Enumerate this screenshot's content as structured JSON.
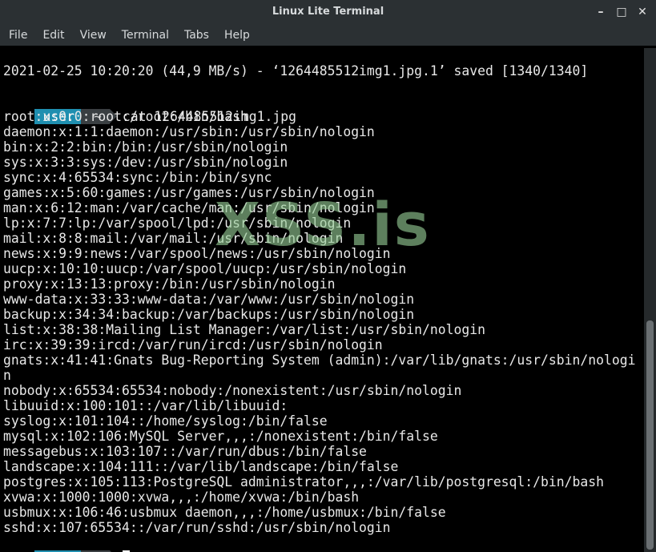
{
  "window": {
    "title": "Linux Lite Terminal",
    "controls": [
      "minimize-icon",
      "maximize-icon",
      "close-icon"
    ],
    "minimize_glyph": "–",
    "maximize_glyph": "□",
    "close_glyph": "✕"
  },
  "menu": [
    "File",
    "Edit",
    "View",
    "Terminal",
    "Tabs",
    "Help"
  ],
  "terminal": {
    "top_line": "2021-02-25 10:20:20 (44,9 MB/s) - ‘1264485512img1.jpg.1’ saved [1340/1340]",
    "prompt_user": "user",
    "prompt_dir": "~",
    "command": "cat 1264485512img1.jpg",
    "output": [
      "root:x:0:0:root:/root:/bin/bash",
      "daemon:x:1:1:daemon:/usr/sbin:/usr/sbin/nologin",
      "bin:x:2:2:bin:/bin:/usr/sbin/nologin",
      "sys:x:3:3:sys:/dev:/usr/sbin/nologin",
      "sync:x:4:65534:sync:/bin:/bin/sync",
      "games:x:5:60:games:/usr/games:/usr/sbin/nologin",
      "man:x:6:12:man:/var/cache/man:/usr/sbin/nologin",
      "lp:x:7:7:lp:/var/spool/lpd:/usr/sbin/nologin",
      "mail:x:8:8:mail:/var/mail:/usr/sbin/nologin",
      "news:x:9:9:news:/var/spool/news:/usr/sbin/nologin",
      "uucp:x:10:10:uucp:/var/spool/uucp:/usr/sbin/nologin",
      "proxy:x:13:13:proxy:/bin:/usr/sbin/nologin",
      "www-data:x:33:33:www-data:/var/www:/usr/sbin/nologin",
      "backup:x:34:34:backup:/var/backups:/usr/sbin/nologin",
      "list:x:38:38:Mailing List Manager:/var/list:/usr/sbin/nologin",
      "irc:x:39:39:ircd:/var/run/ircd:/usr/sbin/nologin",
      "gnats:x:41:41:Gnats Bug-Reporting System (admin):/var/lib/gnats:/usr/sbin/nologi",
      "n",
      "nobody:x:65534:65534:nobody:/nonexistent:/usr/sbin/nologin",
      "libuuid:x:100:101::/var/lib/libuuid:",
      "syslog:x:101:104::/home/syslog:/bin/false",
      "mysql:x:102:106:MySQL Server,,,:/nonexistent:/bin/false",
      "messagebus:x:103:107::/var/run/dbus:/bin/false",
      "landscape:x:104:111::/var/lib/landscape:/bin/false",
      "postgres:x:105:113:PostgreSQL administrator,,,:/var/lib/postgresql:/bin/bash",
      "xvwa:x:1000:1000:xvwa,,,:/home/xvwa:/bin/bash",
      "usbmux:x:106:46:usbmux daemon,,,:/home/usbmux:/bin/false",
      "sshd:x:107:65534::/var/run/sshd:/usr/sbin/nologin"
    ]
  },
  "watermark": "XSS.is"
}
